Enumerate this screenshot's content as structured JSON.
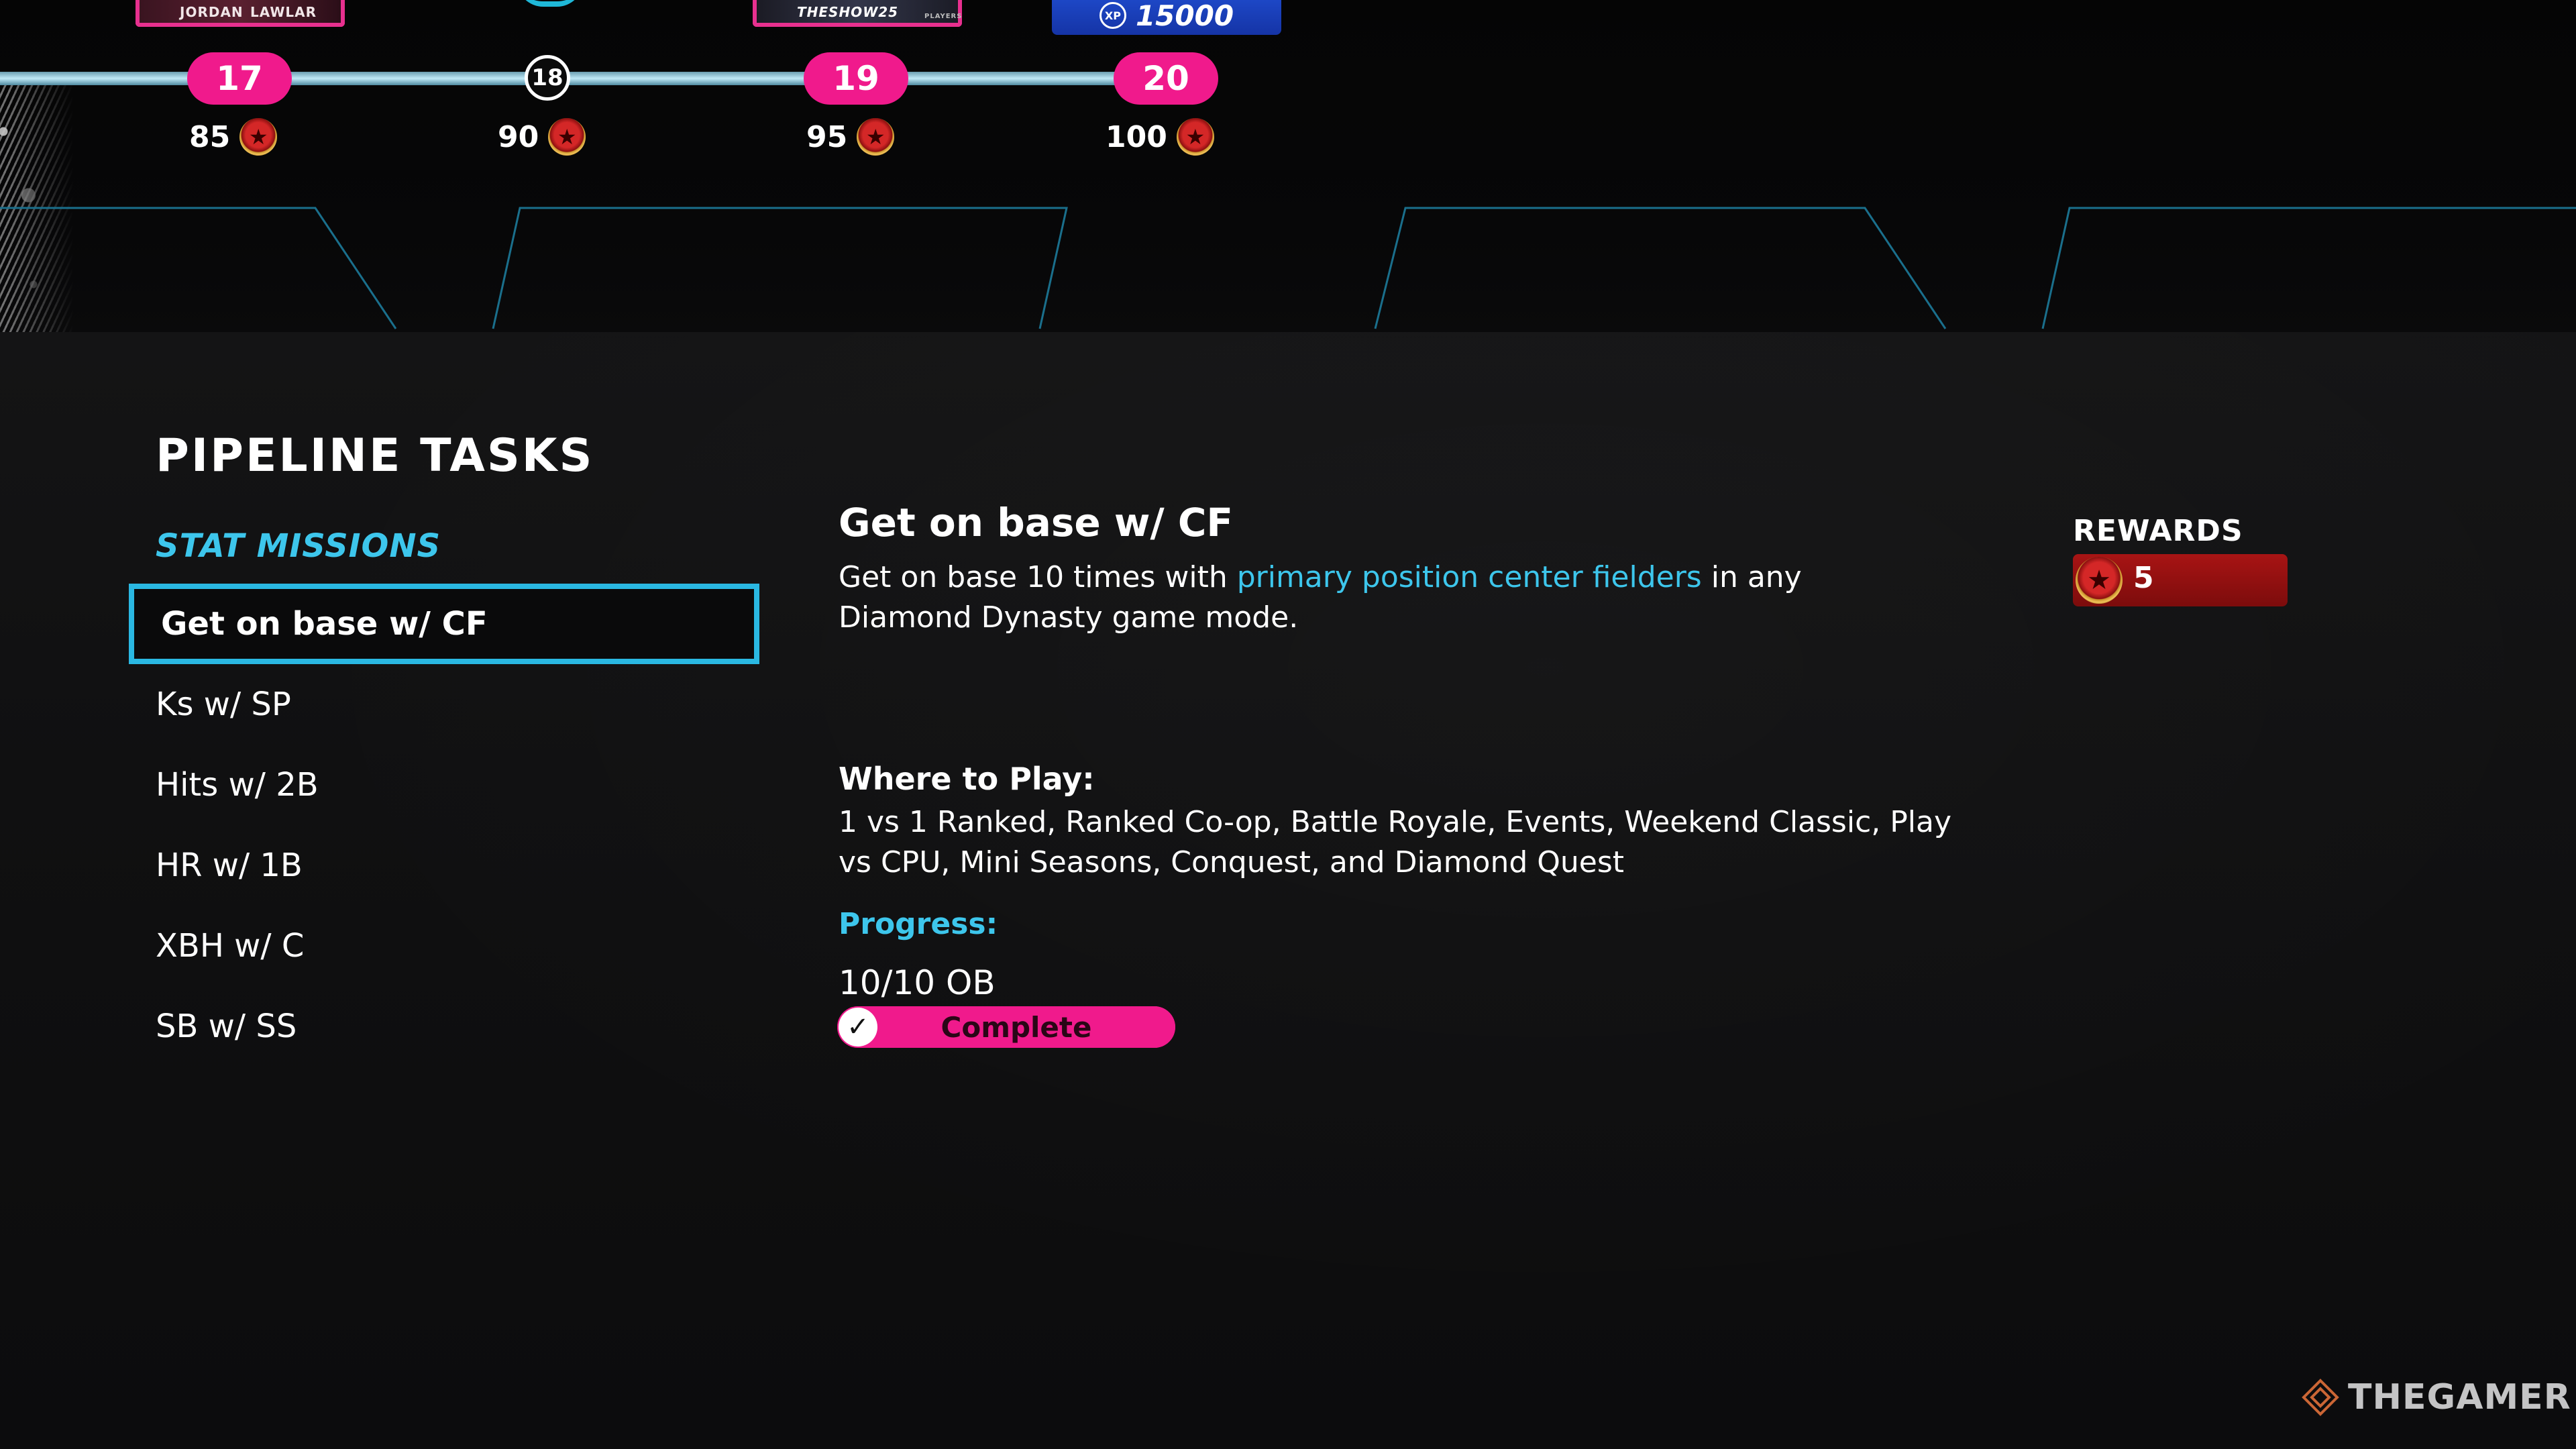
{
  "colors": {
    "accent_pink": "#f01a8c",
    "accent_cyan": "#3dc6ec",
    "xp_blue": "#1e49c9",
    "reward_red": "#a81414"
  },
  "track": {
    "cards": [
      {
        "line1": "JORDAN",
        "line2": "LAWLAR"
      },
      {
        "line1": "THESHOW25",
        "line2": "PLAYERS"
      }
    ],
    "xp_card": {
      "badge": "XP",
      "amount": "15000"
    },
    "levels": [
      {
        "level": "17",
        "points": "85",
        "style": "pill"
      },
      {
        "level": "18",
        "points": "90",
        "style": "circle"
      },
      {
        "level": "19",
        "points": "95",
        "style": "pill"
      },
      {
        "level": "20",
        "points": "100",
        "style": "pill"
      }
    ],
    "point_icon": "star-coin-icon"
  },
  "panel": {
    "heading": "PIPELINE TASKS",
    "category": "STAT MISSIONS",
    "tasks": [
      {
        "label": "Get on base w/ CF",
        "selected": true
      },
      {
        "label": "Ks w/ SP",
        "selected": false
      },
      {
        "label": "Hits w/ 2B",
        "selected": false
      },
      {
        "label": "HR w/ 1B",
        "selected": false
      },
      {
        "label": "XBH w/ C",
        "selected": false
      },
      {
        "label": "SB w/ SS",
        "selected": false
      }
    ]
  },
  "detail": {
    "title": "Get on base w/ CF",
    "description_before": "Get on base 10 times with ",
    "description_highlight": "primary position center fielders",
    "description_after": " in any Diamond Dynasty game mode.",
    "where_label": "Where to Play:",
    "where_text": "1 vs 1 Ranked, Ranked Co-op, Battle Royale, Events, Weekend Classic, Play vs CPU, Mini Seasons, Conquest, and Diamond Quest",
    "progress_label": "Progress:",
    "progress_value": "10/10 OB",
    "progress_fraction": 1.0,
    "status": "Complete",
    "status_icon": "checkmark-icon"
  },
  "rewards": {
    "label": "REWARDS",
    "icon": "star-coin-icon",
    "quantity": "5"
  },
  "watermark": {
    "text": "THEGAMER",
    "icon": "thegamer-logo-icon"
  }
}
